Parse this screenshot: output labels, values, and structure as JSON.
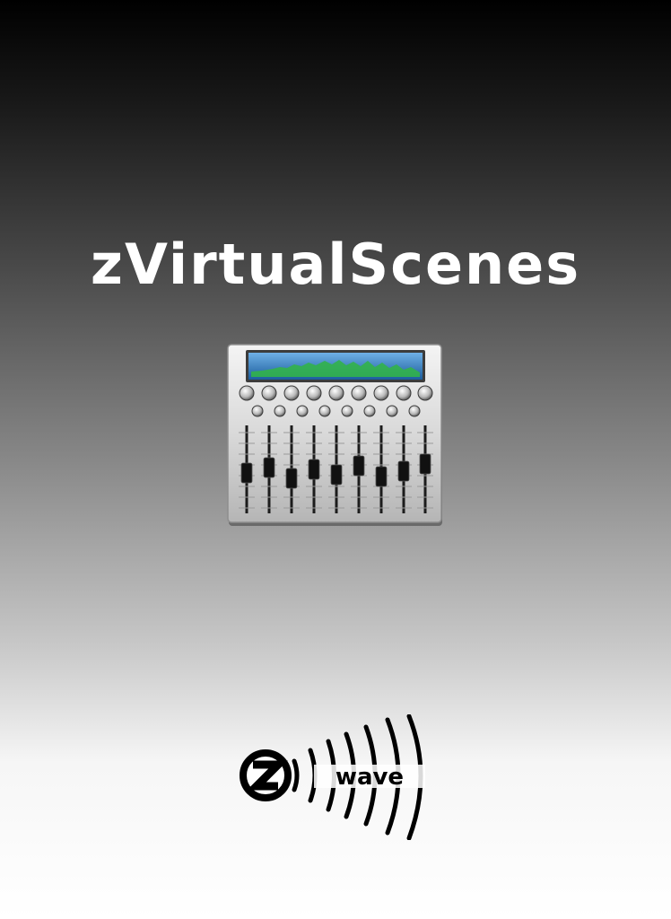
{
  "splash": {
    "title": "zVirtualScenes",
    "app_icon": "mixing-console-icon",
    "brand_logo": {
      "icon": "zwave-logo",
      "text": "wave"
    }
  },
  "colors": {
    "background_top": "#000000",
    "background_bottom": "#ffffff",
    "title_text": "#ffffff",
    "lcd_screen": "#2a7fc0",
    "waveform": "#32b34a",
    "logo": "#000000"
  }
}
